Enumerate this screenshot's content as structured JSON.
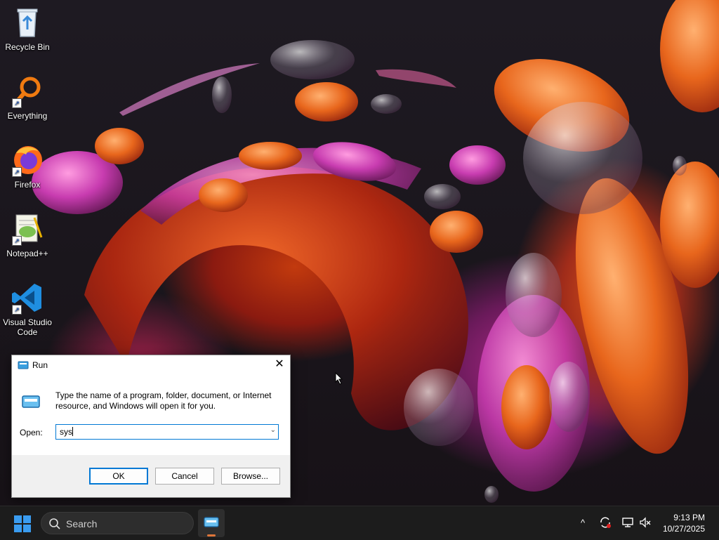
{
  "desktop": {
    "icons": [
      {
        "label": "Recycle Bin",
        "icon": "recycle-bin-icon"
      },
      {
        "label": "Everything",
        "icon": "everything-search-icon"
      },
      {
        "label": "Firefox",
        "icon": "firefox-icon"
      },
      {
        "label": "Notepad++",
        "icon": "notepad-plus-plus-icon"
      },
      {
        "label": "Visual Studio Code",
        "icon": "vscode-icon"
      }
    ]
  },
  "run_dialog": {
    "title": "Run",
    "description": "Type the name of a program, folder, document, or Internet resource, and Windows will open it for you.",
    "open_label": "Open:",
    "input_value": "sys",
    "ok_label": "OK",
    "cancel_label": "Cancel",
    "browse_label": "Browse...",
    "close_glyph": "✕"
  },
  "taskbar": {
    "search_placeholder": "Search",
    "tray": {
      "overflow_glyph": "^"
    },
    "clock": {
      "time": "9:13 PM",
      "date": "10/27/2025"
    }
  },
  "colors": {
    "accent": "#0078d4",
    "taskbar_bg": "#1c1c1c",
    "running_indicator": "#e0763a"
  }
}
